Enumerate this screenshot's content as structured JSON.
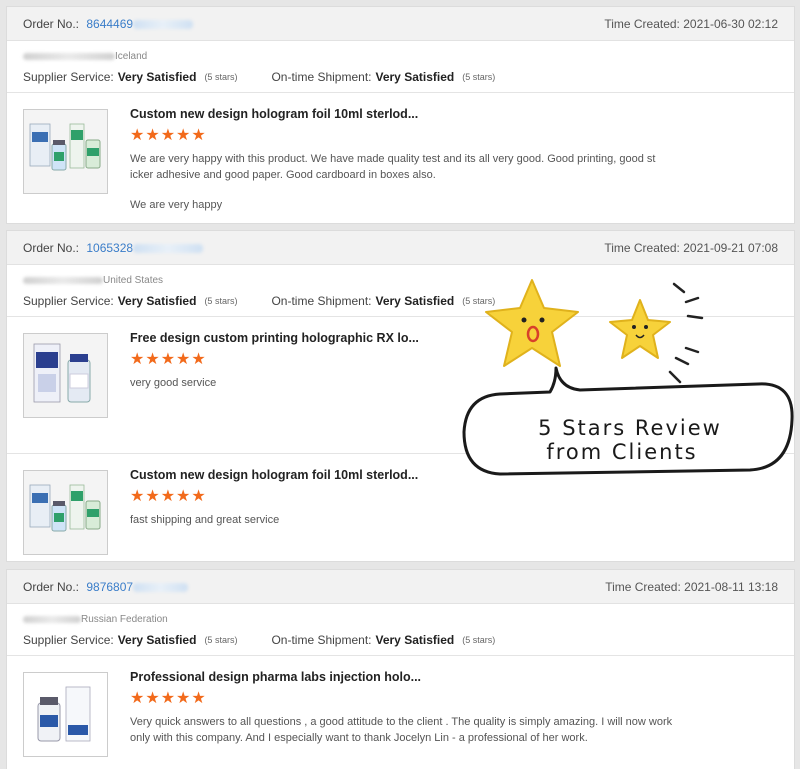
{
  "labels": {
    "order_no": "Order No.:",
    "time_created": "Time Created:",
    "supplier_service": "Supplier Service:",
    "ontime_shipment": "On-time Shipment:"
  },
  "orders": [
    {
      "order_no": "8644469",
      "time": "2021-06-30 02:12",
      "country": "Iceland",
      "supplier_rating": "Very Satisfied",
      "supplier_stars": "(5 stars)",
      "shipment_rating": "Very Satisfied",
      "shipment_stars": "(5 stars)",
      "items": [
        {
          "title": "Custom new design hologram foil 10ml sterlod...",
          "stars": "★★★★★",
          "review": "We are very happy with this product. We have made quality test and its all very good. Good printing, good st icker adhesive and good paper. Good cardboard in boxes also.",
          "review_extra": "We are very happy"
        }
      ]
    },
    {
      "order_no": "1065328",
      "time": "2021-09-21 07:08",
      "country": "United States",
      "supplier_rating": "Very Satisfied",
      "supplier_stars": "(5 stars)",
      "shipment_rating": "Very Satisfied",
      "shipment_stars": "(5 stars)",
      "items": [
        {
          "title": "Free design custom printing holographic RX lo...",
          "stars": "★★★★★",
          "review": "very good service"
        },
        {
          "title": "Custom new design hologram foil 10ml sterlod...",
          "stars": "★★★★★",
          "review": "fast shipping and great service"
        }
      ]
    },
    {
      "order_no": "9876807",
      "time": "2021-08-11 13:18",
      "country": "Russian Federation",
      "supplier_rating": "Very Satisfied",
      "supplier_stars": "(5 stars)",
      "shipment_rating": "Very Satisfied",
      "shipment_stars": "(5 stars)",
      "items": [
        {
          "title": "Professional design pharma labs injection holo...",
          "stars": "★★★★★",
          "review": "Very quick answers to all questions , a good attitude to the client . The quality is simply amazing. I will now work only with this company. And I especially want to thank Jocelyn Lin - a professional of her work."
        }
      ]
    }
  ],
  "decoration": {
    "line1": "5 Stars Review",
    "line2": "from Clients",
    "icons": [
      "star-surprised-icon",
      "star-smiling-icon"
    ]
  },
  "colors": {
    "star": "#f26a1b",
    "order_link": "#3a7dc9",
    "header_bg": "#f2f2f2",
    "cartoon_star": "#f7d23a"
  }
}
